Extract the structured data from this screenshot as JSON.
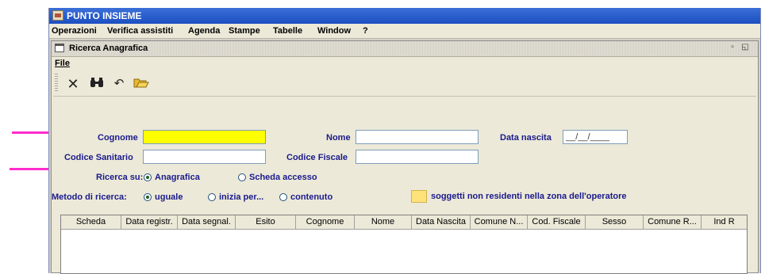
{
  "app": {
    "title": "PUNTO INSIEME"
  },
  "menubar": {
    "items": [
      "Operazioni",
      "Verifica assistiti",
      "Agenda",
      "Stampe",
      "Tabelle",
      "Window",
      "?"
    ]
  },
  "internal_frame": {
    "title": "Ricerca Anagrafica",
    "file_menu": "File"
  },
  "toolbar": {
    "icons": [
      "close-icon",
      "binoculars-icon",
      "undo-icon",
      "open-folder-icon"
    ]
  },
  "form": {
    "cognome_label": "Cognome",
    "cognome_value": "",
    "nome_label": "Nome",
    "nome_value": "",
    "data_nascita_label": "Data nascita",
    "data_nascita_value": "__/__/____",
    "codice_sanitario_label": "Codice Sanitario",
    "codice_sanitario_value": "",
    "codice_fiscale_label": "Codice Fiscale",
    "codice_fiscale_value": "",
    "ricerca_su_label": "Ricerca su:",
    "ricerca_su_options": [
      "Anagrafica",
      "Scheda accesso"
    ],
    "ricerca_su_selected": "Anagrafica",
    "metodo_label": "Metodo di ricerca:",
    "metodo_options": [
      "uguale",
      "inizia per...",
      "contenuto"
    ],
    "metodo_selected": "uguale",
    "legend_text": "soggetti non residenti nella zona dell'operatore",
    "legend_color": "#ffe27a",
    "highlight_color": "#ffff00"
  },
  "table": {
    "columns": [
      "Scheda",
      "Data registr.",
      "Data segnal.",
      "Esito",
      "Cognome",
      "Nome",
      "Data Nascita",
      "Comune N...",
      "Cod. Fiscale",
      "Sesso",
      "Comune R...",
      "Ind R"
    ],
    "rows": []
  },
  "annotation": {
    "arrow_color": "#ff2ccc"
  }
}
